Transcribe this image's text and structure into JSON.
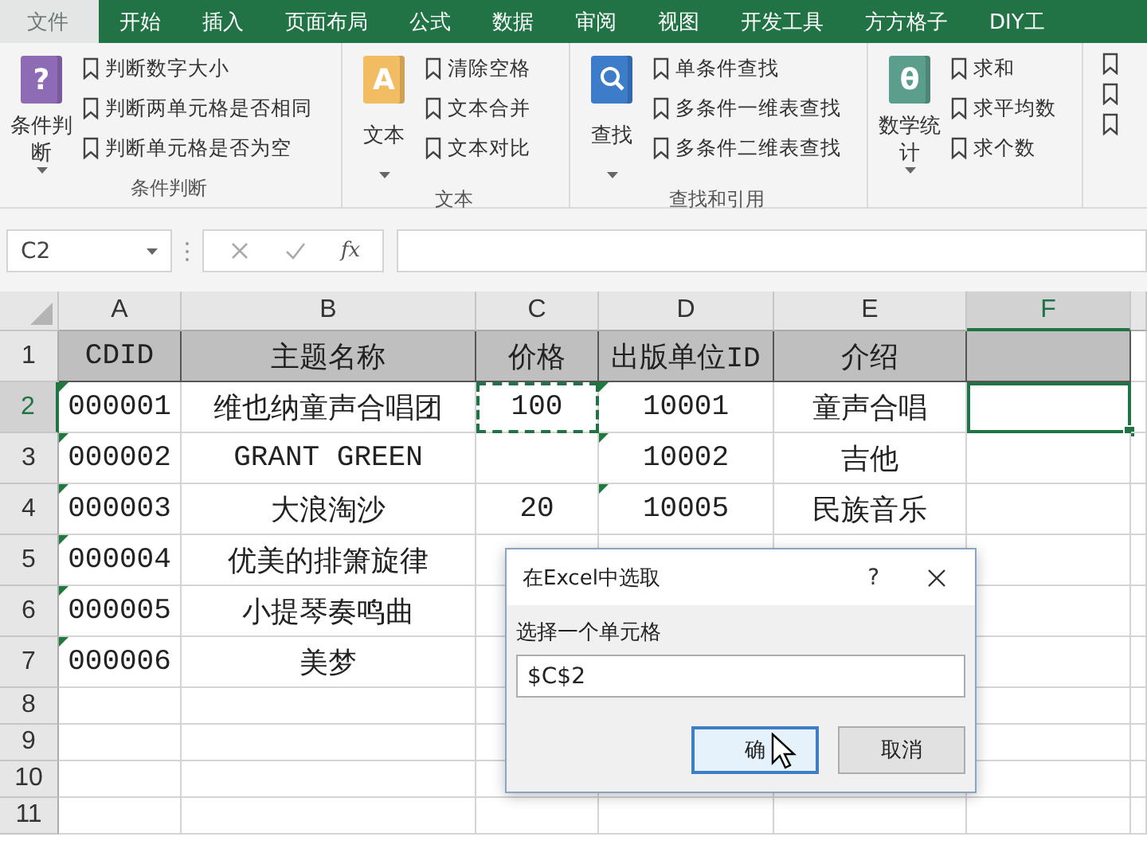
{
  "tabs": [
    {
      "label": "文件",
      "selected": true
    },
    {
      "label": "开始",
      "selected": false
    },
    {
      "label": "插入",
      "selected": false
    },
    {
      "label": "页面布局",
      "selected": false
    },
    {
      "label": "公式",
      "selected": false
    },
    {
      "label": "数据",
      "selected": false
    },
    {
      "label": "审阅",
      "selected": false
    },
    {
      "label": "视图",
      "selected": false
    },
    {
      "label": "开发工具",
      "selected": false
    },
    {
      "label": "方方格子",
      "selected": false
    },
    {
      "label": "DIY工",
      "selected": false
    }
  ],
  "ribbon_groups": [
    {
      "label": "条件判断",
      "big_button": {
        "label": "条件判断",
        "glyph": "?",
        "color": "#8e6bb5",
        "caret_inline": true
      },
      "items": [
        {
          "label": "判断数字大小"
        },
        {
          "label": "判断两单元格是否相同"
        },
        {
          "label": "判断单元格是否为空"
        }
      ]
    },
    {
      "label": "文本",
      "big_button": {
        "label": "文本",
        "glyph": "A",
        "color": "#f2bd62",
        "caret_inline": false
      },
      "items": [
        {
          "label": "清除空格"
        },
        {
          "label": "文本合并"
        },
        {
          "label": "文本对比"
        }
      ]
    },
    {
      "label": "查找和引用",
      "big_button": {
        "label": "查找",
        "color": "#3d7cc9",
        "caret_inline": false
      },
      "items": [
        {
          "label": "单条件查找"
        },
        {
          "label": "多条件一维表查找"
        },
        {
          "label": "多条件二维表查找"
        }
      ]
    },
    {
      "big_button": {
        "label": "数学统计",
        "glyph": "θ",
        "color": "#5b9e8c",
        "caret_inline": true
      },
      "items": [
        {
          "label": "求和"
        },
        {
          "label": "求平均数"
        },
        {
          "label": "求个数"
        }
      ]
    }
  ],
  "formula_bar": {
    "name_box": "C2",
    "fx": "fx"
  },
  "columns": [
    {
      "label": "A",
      "selected": false
    },
    {
      "label": "B",
      "selected": false
    },
    {
      "label": "C",
      "selected": false
    },
    {
      "label": "D",
      "selected": false
    },
    {
      "label": "E",
      "selected": false
    },
    {
      "label": "F",
      "selected": true
    }
  ],
  "rows": [
    {
      "label": "1",
      "selected": false,
      "shaded": true,
      "cells": [
        {
          "text": "CDID",
          "flag": false,
          "selected": false,
          "marked": false
        },
        {
          "text": "主题名称",
          "flag": false,
          "selected": false,
          "marked": false
        },
        {
          "text": "价格",
          "flag": false,
          "selected": false,
          "marked": false
        },
        {
          "text": "出版单位ID",
          "flag": false,
          "selected": false,
          "marked": false
        },
        {
          "text": "介绍",
          "flag": false,
          "selected": false,
          "marked": false
        },
        {
          "flag": false,
          "selected": false,
          "marked": false
        }
      ]
    },
    {
      "label": "2",
      "selected": true,
      "shaded": false,
      "cells": [
        {
          "text": "000001",
          "flag": true,
          "selected": false,
          "marked": false
        },
        {
          "text": "维也纳童声合唱团",
          "flag": false,
          "selected": false,
          "marked": false
        },
        {
          "text": "100",
          "flag": false,
          "selected": false,
          "marked": true
        },
        {
          "text": "10001",
          "flag": true,
          "selected": false,
          "marked": false
        },
        {
          "text": "童声合唱",
          "flag": false,
          "selected": false,
          "marked": false
        },
        {
          "flag": false,
          "selected": true,
          "marked": false
        }
      ]
    },
    {
      "label": "3",
      "selected": false,
      "shaded": false,
      "cells": [
        {
          "text": "000002",
          "flag": true,
          "selected": false,
          "marked": false
        },
        {
          "text": "GRANT GREEN",
          "flag": false,
          "selected": false,
          "marked": false
        },
        {
          "flag": false,
          "selected": false,
          "marked": false
        },
        {
          "text": "10002",
          "flag": true,
          "selected": false,
          "marked": false
        },
        {
          "text": "吉他",
          "flag": false,
          "selected": false,
          "marked": false
        },
        {
          "flag": false,
          "selected": false,
          "marked": false
        }
      ]
    },
    {
      "label": "4",
      "selected": false,
      "shaded": false,
      "cells": [
        {
          "text": "000003",
          "flag": true,
          "selected": false,
          "marked": false
        },
        {
          "text": "大浪淘沙",
          "flag": false,
          "selected": false,
          "marked": false
        },
        {
          "text": "20",
          "flag": false,
          "selected": false,
          "marked": false
        },
        {
          "text": "10005",
          "flag": true,
          "selected": false,
          "marked": false
        },
        {
          "text": "民族音乐",
          "flag": false,
          "selected": false,
          "marked": false
        },
        {
          "flag": false,
          "selected": false,
          "marked": false
        }
      ]
    },
    {
      "label": "5",
      "selected": false,
      "shaded": false,
      "cells": [
        {
          "text": "000004",
          "flag": true,
          "selected": false,
          "marked": false
        },
        {
          "text": "优美的排箫旋律",
          "flag": false,
          "selected": false,
          "marked": false
        }
      ]
    },
    {
      "label": "6",
      "selected": false,
      "shaded": false,
      "cells": [
        {
          "text": "000005",
          "flag": true,
          "selected": false,
          "marked": false
        },
        {
          "text": "小提琴奏鸣曲",
          "flag": false,
          "selected": false,
          "marked": false
        }
      ]
    },
    {
      "label": "7",
      "selected": false,
      "shaded": false,
      "cells": [
        {
          "text": "000006",
          "flag": true,
          "selected": false,
          "marked": false
        },
        {
          "text": "美梦",
          "flag": false,
          "selected": false,
          "marked": false
        }
      ]
    },
    {
      "label": "8",
      "selected": false
    },
    {
      "label": "9",
      "selected": false
    },
    {
      "label": "10",
      "selected": false
    },
    {
      "label": "11",
      "selected": false
    }
  ],
  "dialog": {
    "title": "在Excel中选取",
    "help": "?",
    "prompt": "选择一个单元格",
    "value": "$C$2",
    "buttons": [
      {
        "label": "确",
        "kind": "default"
      },
      {
        "label": "取消",
        "kind": "normal"
      }
    ]
  }
}
